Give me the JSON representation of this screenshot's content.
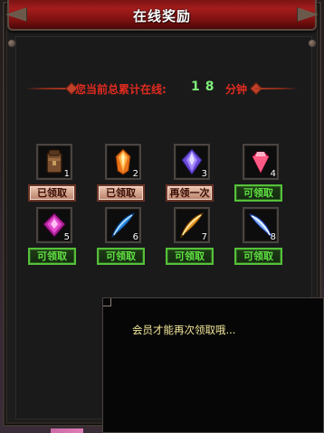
{
  "window": {
    "title": "在线奖励"
  },
  "online": {
    "label": "您当前总累计在线:",
    "value": "18",
    "unit": "分钟"
  },
  "rewards": [
    {
      "index": "1",
      "icon": "leather-bag-icon",
      "status": "claimed",
      "button_label": "已领取"
    },
    {
      "index": "2",
      "icon": "amber-crystal-icon",
      "status": "claimed",
      "button_label": "已领取"
    },
    {
      "index": "3",
      "icon": "purple-diamond-icon",
      "status": "claimed",
      "button_label": "再领一次"
    },
    {
      "index": "4",
      "icon": "pink-gem-icon",
      "status": "claimable",
      "button_label": "可领取"
    },
    {
      "index": "5",
      "icon": "magenta-gem-icon",
      "status": "claimable",
      "button_label": "可领取"
    },
    {
      "index": "6",
      "icon": "blue-feather-icon",
      "status": "claimable",
      "button_label": "可领取"
    },
    {
      "index": "7",
      "icon": "golden-feather-icon",
      "status": "claimable",
      "button_label": "可领取"
    },
    {
      "index": "8",
      "icon": "white-blue-feather-icon",
      "status": "claimable",
      "button_label": "可领取"
    }
  ],
  "tooltip": {
    "text": "会员才能再次领取哦..."
  },
  "colors": {
    "title_bar": "#a51d1d",
    "label_red": "#e12b1f",
    "value_green": "#7ef07a",
    "claimable_green": "#5fe042",
    "tooltip_text": "#f2e79a"
  }
}
